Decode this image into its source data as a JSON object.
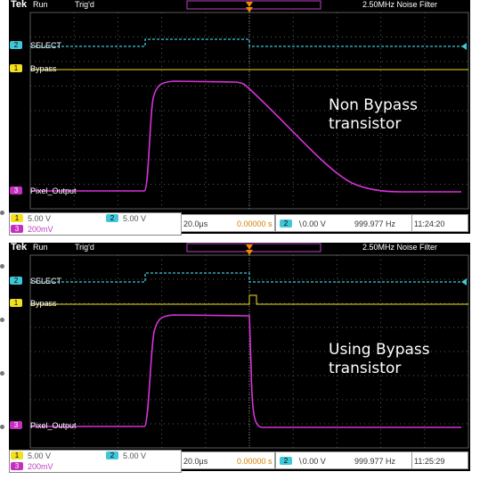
{
  "scopes": [
    {
      "brand": "Tek",
      "status": "Run",
      "trigger": "Trig'd",
      "bandwidth": "2.50MHz  Noise Filter",
      "ch2_badge": "2",
      "ch1_badge": "1",
      "ch3_badge": "3",
      "ch2_name": "SELECT",
      "ch1_name": "Bypass",
      "ch3_name": "Pixel_Output",
      "annotation": "Non Bypass\ntransistor",
      "ch1_scale": "5.00 V",
      "ch2_scale": "5.00 V",
      "ch3_scale": "200mV",
      "timebase": "20.0μs",
      "position": "0.00000 s",
      "trig_source": "2",
      "trig_level": "∖0.00 V",
      "frequency": "999.977 Hz",
      "time": "11:24:20"
    },
    {
      "brand": "Tek",
      "status": "Run",
      "trigger": "Trig'd",
      "bandwidth": "2.50MHz  Noise Filter",
      "ch2_badge": "2",
      "ch1_badge": "1",
      "ch3_badge": "3",
      "ch2_name": "SELECT",
      "ch1_name": "Bypass",
      "ch3_name": "Pixel_Output",
      "annotation": "Using Bypass\ntransistor",
      "ch1_scale": "5.00 V",
      "ch2_scale": "5.00 V",
      "ch3_scale": "200mV",
      "timebase": "20.0μs",
      "position": "0.00000 s",
      "trig_source": "2",
      "trig_level": "∖0.00 V",
      "frequency": "999.977 Hz",
      "time": "11:25:29"
    }
  ],
  "colors": {
    "ch1": "#f2e020",
    "ch2": "#3fc7d8",
    "ch3": "#d633d6",
    "trigger_marker": "#f08a00",
    "grid": "#5a5a5a"
  }
}
